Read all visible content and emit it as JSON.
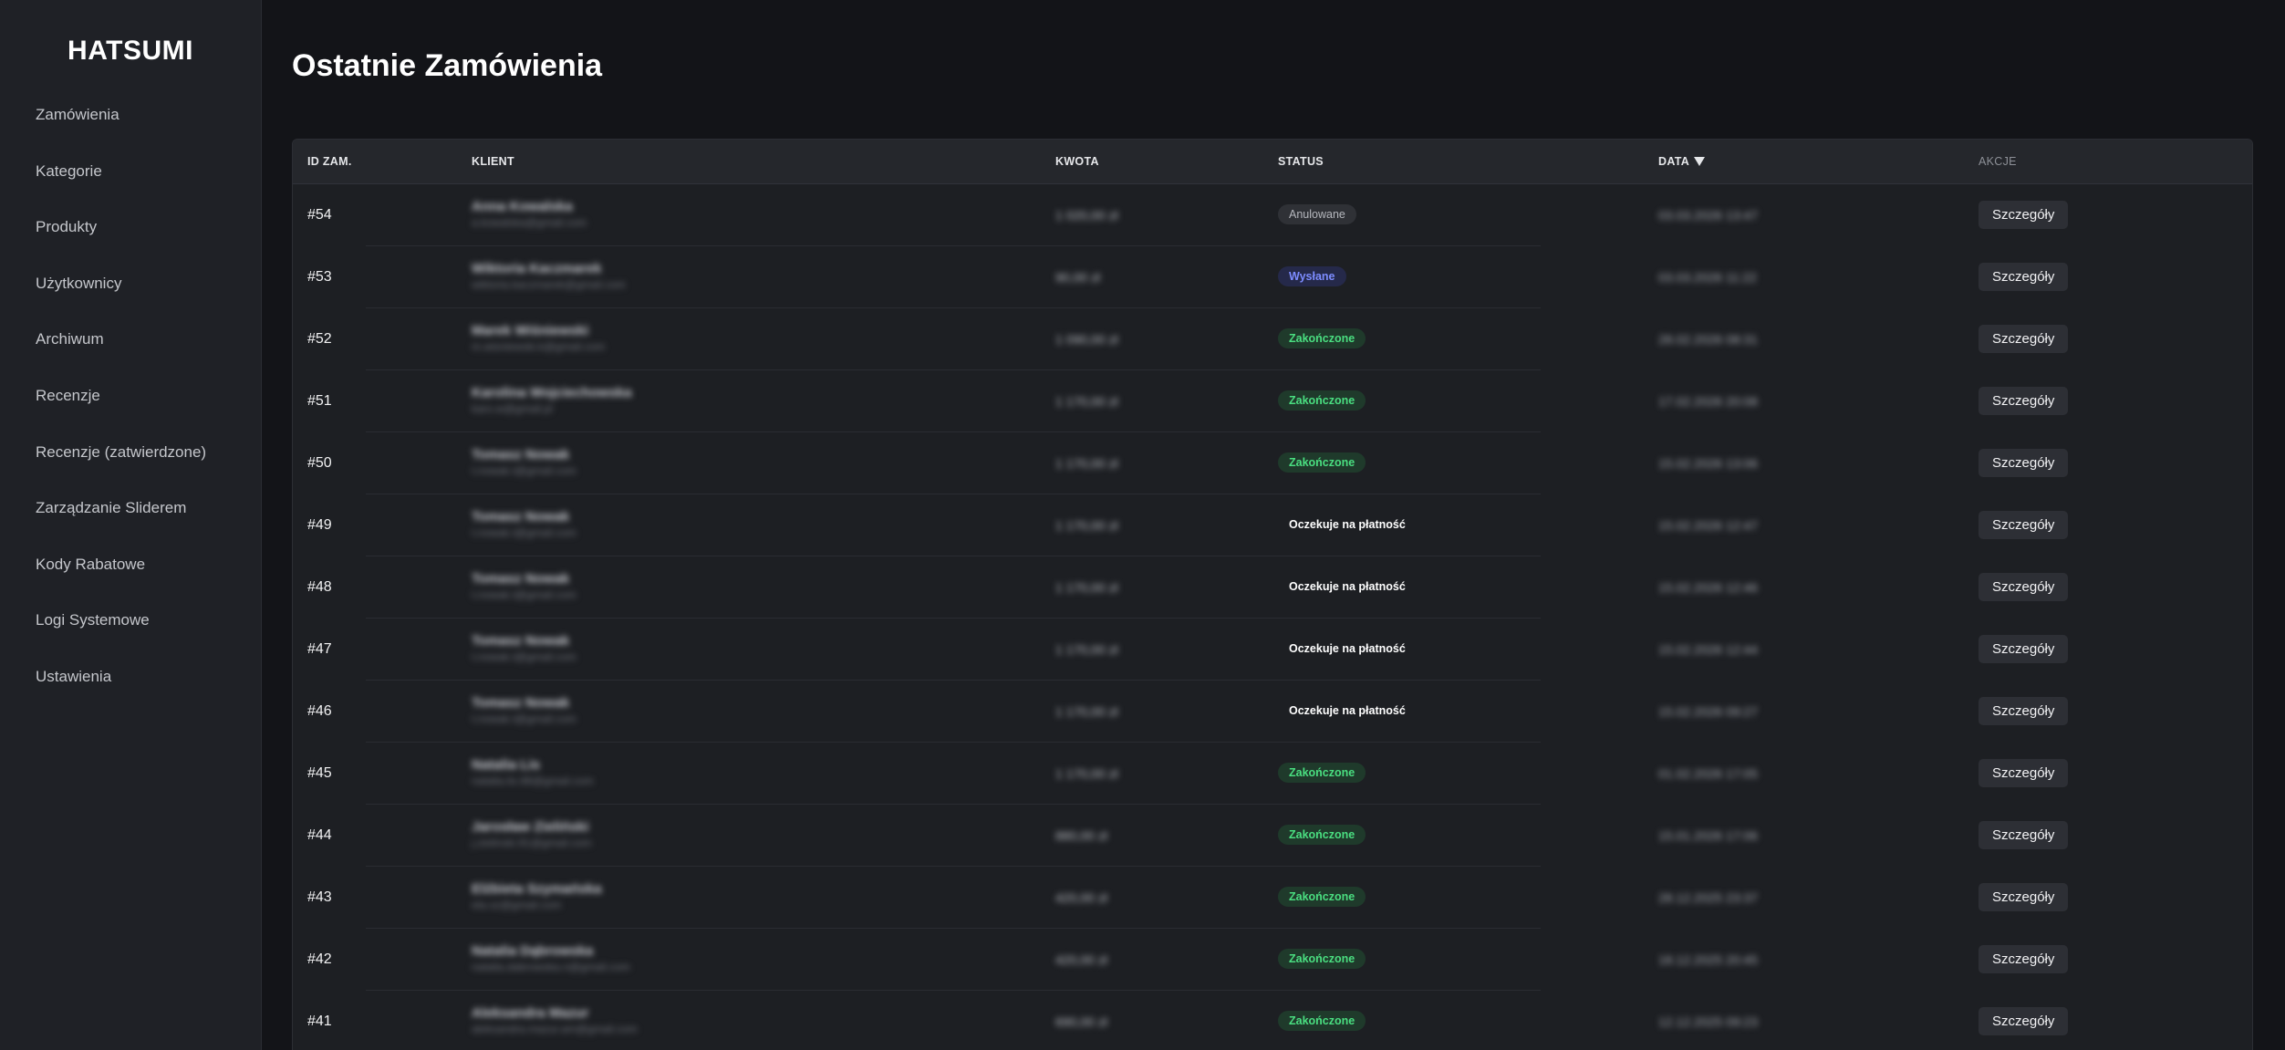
{
  "brand": "HATSUMI",
  "nav": [
    {
      "label": "Zamówienia"
    },
    {
      "label": "Kategorie"
    },
    {
      "label": "Produkty"
    },
    {
      "label": "Użytkownicy"
    },
    {
      "label": "Archiwum"
    },
    {
      "label": "Recenzje"
    },
    {
      "label": "Recenzje (zatwierdzone)"
    },
    {
      "label": "Zarządzanie Sliderem"
    },
    {
      "label": "Kody Rabatowe"
    },
    {
      "label": "Logi Systemowe"
    },
    {
      "label": "Ustawienia"
    }
  ],
  "page_title": "Ostatnie Zamówienia",
  "table": {
    "headers": {
      "id": "ID ZAM.",
      "client": "KLIENT",
      "amount": "KWOTA",
      "status": "STATUS",
      "date": "DATA",
      "actions": "AKCJE"
    },
    "action_label": "Szczegóły",
    "status_colors": {
      "cancel": "#b5b7bd",
      "sent": "#7d8cff",
      "done": "#4ade80",
      "pending": "#ffffff"
    },
    "rows": [
      {
        "id": "#54",
        "client_name": "Anna Kowalska",
        "client_email": "a.kowalska@gmail.com",
        "amount": "1 020,00 zł",
        "status": "Anulowane",
        "status_type": "cancel",
        "date": "03.03.2026 13:47"
      },
      {
        "id": "#53",
        "client_name": "Wiktoria Kaczmarek",
        "client_email": "wiktoria.kaczmarek@gmail.com",
        "amount": "90,00 zł",
        "status": "Wysłane",
        "status_type": "sent",
        "date": "03.03.2026 11:22"
      },
      {
        "id": "#52",
        "client_name": "Marek Wiśniewski",
        "client_email": "m.wisniewski.k@gmail.com",
        "amount": "1 090,00 zł",
        "status": "Zakończone",
        "status_type": "done",
        "date": "28.02.2026 08:31"
      },
      {
        "id": "#51",
        "client_name": "Karolina Wojciechowska",
        "client_email": "karo.w@gmail.pl",
        "amount": "1 170,00 zł",
        "status": "Zakończone",
        "status_type": "done",
        "date": "17.02.2026 20:08"
      },
      {
        "id": "#50",
        "client_name": "Tomasz Nowak",
        "client_email": "t.nowak.t@gmail.com",
        "amount": "1 170,00 zł",
        "status": "Zakończone",
        "status_type": "done",
        "date": "15.02.2026 13:06"
      },
      {
        "id": "#49",
        "client_name": "Tomasz Nowak",
        "client_email": "t.nowak.t@gmail.com",
        "amount": "1 170,00 zł",
        "status": "Oczekuje na płatność",
        "status_type": "pending",
        "date": "15.02.2026 12:47"
      },
      {
        "id": "#48",
        "client_name": "Tomasz Nowak",
        "client_email": "t.nowak.t@gmail.com",
        "amount": "1 170,00 zł",
        "status": "Oczekuje na płatność",
        "status_type": "pending",
        "date": "15.02.2026 12:46"
      },
      {
        "id": "#47",
        "client_name": "Tomasz Nowak",
        "client_email": "t.nowak.t@gmail.com",
        "amount": "1 170,00 zł",
        "status": "Oczekuje na płatność",
        "status_type": "pending",
        "date": "15.02.2026 12:44"
      },
      {
        "id": "#46",
        "client_name": "Tomasz Nowak",
        "client_email": "t.nowak.t@gmail.com",
        "amount": "1 170,00 zł",
        "status": "Oczekuje na płatność",
        "status_type": "pending",
        "date": "15.02.2026 09:27"
      },
      {
        "id": "#45",
        "client_name": "Natalia Lis",
        "client_email": "natalia.lis.88@gmail.com",
        "amount": "1 170,00 zł",
        "status": "Zakończone",
        "status_type": "done",
        "date": "01.02.2026 17:05"
      },
      {
        "id": "#44",
        "client_name": "Jarosław Zieliński",
        "client_email": "j.zielinski.91@gmail.com",
        "amount": "880,00 zł",
        "status": "Zakończone",
        "status_type": "done",
        "date": "15.01.2026 17:06"
      },
      {
        "id": "#43",
        "client_name": "Elżbieta Szymańska",
        "client_email": "ela.sz@gmail.com",
        "amount": "420,00 zł",
        "status": "Zakończone",
        "status_type": "done",
        "date": "28.12.2025 23:37"
      },
      {
        "id": "#42",
        "client_name": "Natalia Dąbrowska",
        "client_email": "natalia.dabrowska.n@gmail.com",
        "amount": "420,00 zł",
        "status": "Zakończone",
        "status_type": "done",
        "date": "18.12.2025 20:45"
      },
      {
        "id": "#41",
        "client_name": "Aleksandra Mazur",
        "client_email": "aleksandra.mazur.am@gmail.com",
        "amount": "690,00 zł",
        "status": "Zakończone",
        "status_type": "done",
        "date": "12.12.2025 09:23"
      }
    ]
  }
}
